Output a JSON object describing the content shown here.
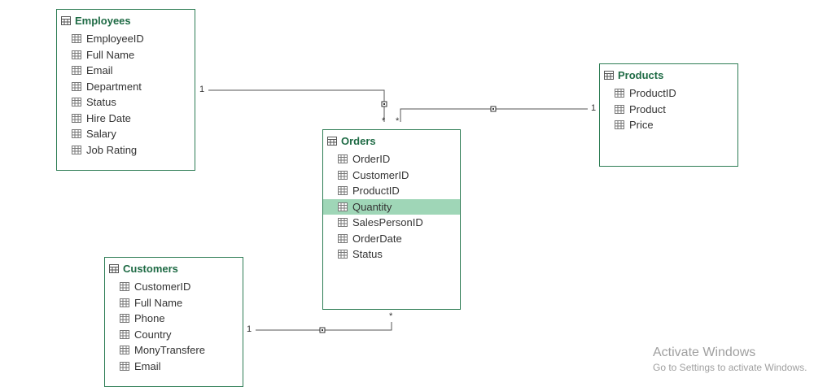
{
  "tables": {
    "employees": {
      "name": "Employees",
      "fields": [
        "EmployeeID",
        "Full Name",
        "Email",
        "Department",
        "Status",
        "Hire Date",
        "Salary",
        "Job Rating"
      ]
    },
    "products": {
      "name": "Products",
      "fields": [
        "ProductID",
        "Product",
        "Price"
      ]
    },
    "orders": {
      "name": "Orders",
      "fields": [
        "OrderID",
        "CustomerID",
        "ProductID",
        "Quantity",
        "SalesPersonID",
        "OrderDate",
        "Status"
      ],
      "selected_field": "Quantity"
    },
    "customers": {
      "name": "Customers",
      "fields": [
        "CustomerID",
        "Full Name",
        "Phone",
        "Country",
        "MonyTransfere",
        "Email"
      ]
    }
  },
  "relationships": {
    "employees_orders": {
      "from_card": "1",
      "to_card": "*"
    },
    "products_orders": {
      "from_card": "1",
      "to_card": "*"
    },
    "customers_orders": {
      "from_card": "1",
      "to_card": "*"
    }
  },
  "watermark": {
    "title": "Activate Windows",
    "subtitle": "Go to Settings to activate Windows."
  },
  "colors": {
    "table_border": "#2e7d55",
    "table_title": "#1f6b45",
    "selected_field": "#9fd6b7",
    "relationship_line": "#555555"
  },
  "icons": {
    "table": "table-grid-icon",
    "field": "column-icon"
  }
}
